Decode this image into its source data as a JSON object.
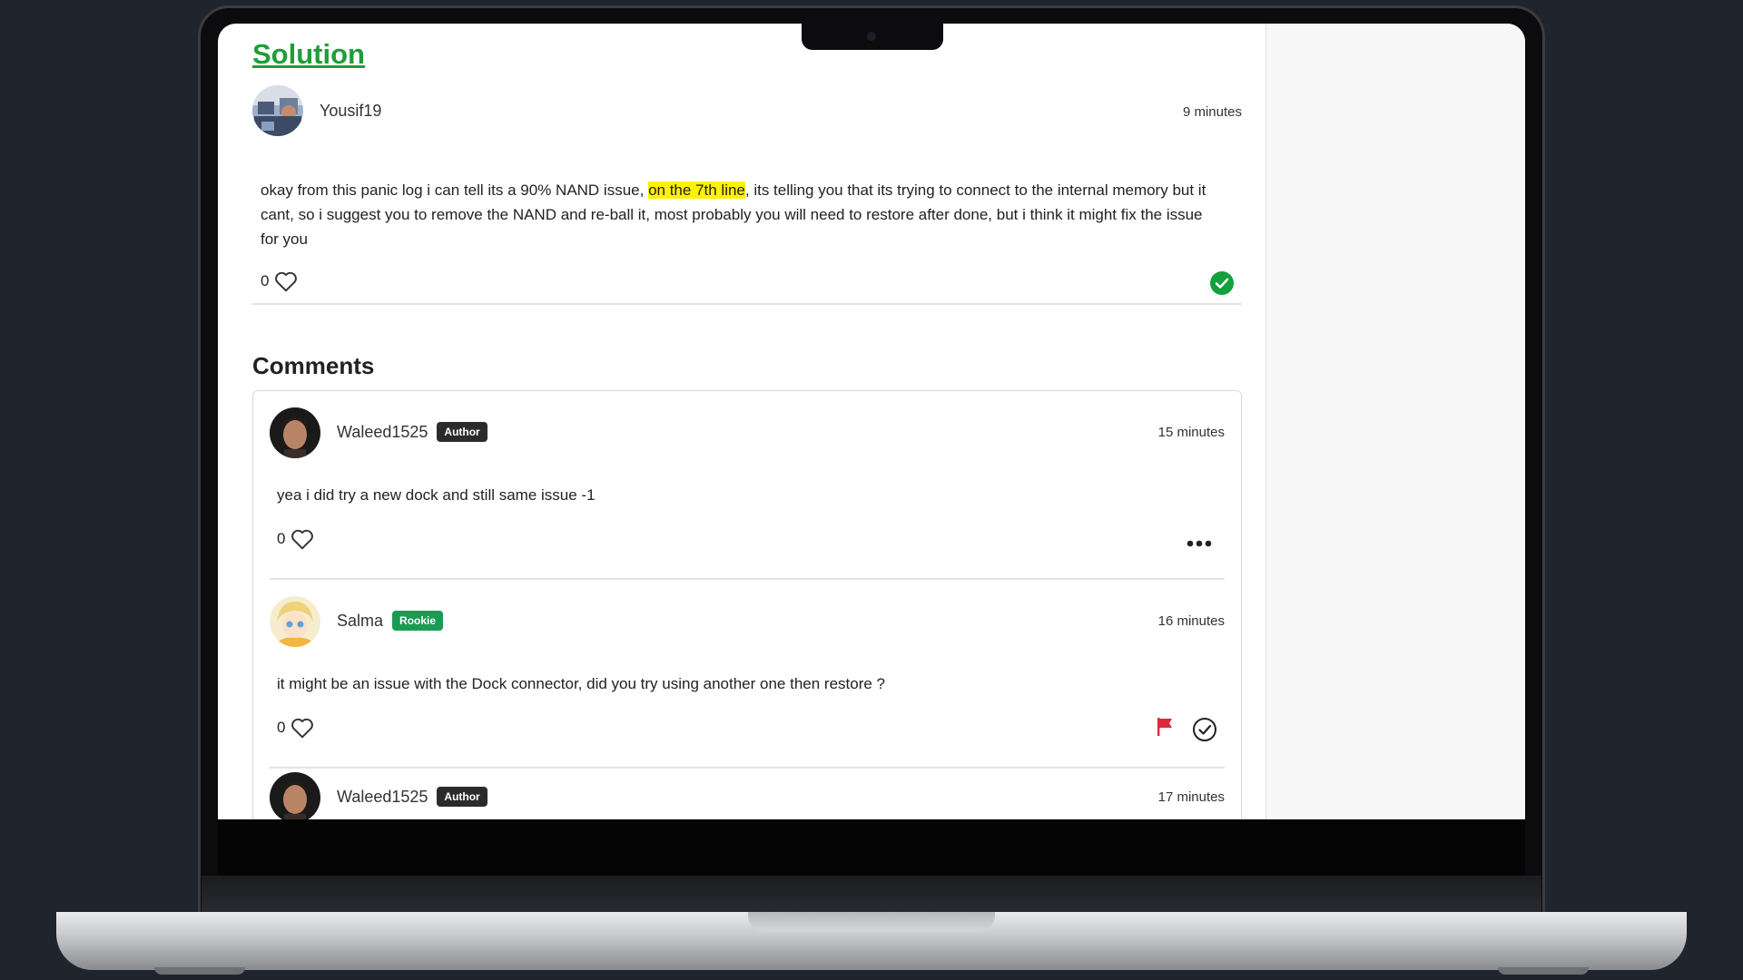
{
  "solution": {
    "title": "Solution",
    "author": "Yousif19",
    "time": "9 minutes",
    "text_before": "okay from this panic log i can tell its a 90% NAND issue, ",
    "text_highlight": "on the 7th line",
    "text_after": ", its telling you that its trying to connect to the internal memory but it cant, so i suggest you to remove the NAND and re-ball it, most probably you will need to restore after done, but i think it might fix the issue for you",
    "likes": "0",
    "accepted_icon": "check-circle-icon"
  },
  "comments": {
    "title": "Comments",
    "items": [
      {
        "author": "Waleed1525",
        "badge": "Author",
        "time": "15 minutes",
        "text": "yea i did try a new dock and still same issue -1",
        "likes": "0",
        "more_icon": "more-dots-icon"
      },
      {
        "author": "Salma",
        "badge": "Rookie",
        "time": "16 minutes",
        "text": "it might be an issue with the Dock connector, did you try using another one then restore ?",
        "likes": "0",
        "flag_icon": "flag-icon",
        "mark_solution_icon": "check-circle-outline-icon"
      },
      {
        "author": "Waleed1525",
        "badge": "Author",
        "time": "17 minutes"
      }
    ]
  },
  "colors": {
    "solution_green": "#1e9e3a",
    "author_badge": "#2b2b2e",
    "rookie_badge": "#1a9b54",
    "highlight": "#fff200",
    "flag_red": "#e0283c",
    "check_green": "#14a03c"
  }
}
